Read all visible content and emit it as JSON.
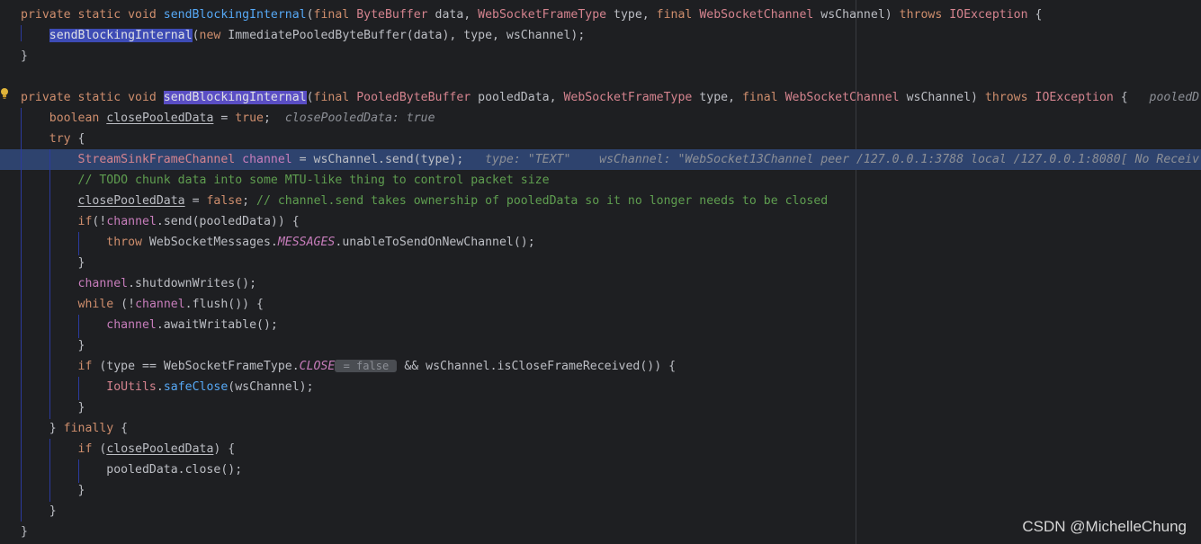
{
  "editor": {
    "lines": [
      {
        "tokens": [
          {
            "t": "private static void ",
            "c": "k"
          },
          {
            "t": "sendBlockingInternal",
            "c": "f"
          },
          {
            "t": "(",
            "c": ""
          },
          {
            "t": "final ",
            "c": "k"
          },
          {
            "t": "ByteBuffer",
            "c": "t"
          },
          {
            "t": " data, ",
            "c": ""
          },
          {
            "t": "WebSocketFrameType",
            "c": "t"
          },
          {
            "t": " type, ",
            "c": ""
          },
          {
            "t": "final ",
            "c": "k"
          },
          {
            "t": "WebSocketChannel",
            "c": "t"
          },
          {
            "t": " wsChannel) ",
            "c": ""
          },
          {
            "t": "throws ",
            "c": "k"
          },
          {
            "t": "IOException",
            "c": "t"
          },
          {
            "t": " {",
            "c": ""
          }
        ]
      },
      {
        "tokens": [
          {
            "t": "    ",
            "c": ""
          },
          {
            "t": "sendBlockingInternal",
            "c": "hl-ref"
          },
          {
            "t": "(",
            "c": ""
          },
          {
            "t": "new ",
            "c": "k"
          },
          {
            "t": "ImmediatePooledByteBuffer(data), type, wsChannel);",
            "c": ""
          }
        ]
      },
      {
        "tokens": [
          {
            "t": "}",
            "c": ""
          }
        ]
      },
      {
        "tokens": []
      },
      {
        "tokens": [
          {
            "t": "private static void ",
            "c": "k"
          },
          {
            "t": "sendBlockingInternal",
            "c": "hl-decl"
          },
          {
            "t": "(",
            "c": ""
          },
          {
            "t": "final ",
            "c": "k"
          },
          {
            "t": "PooledByteBuffer",
            "c": "t"
          },
          {
            "t": " pooledData, ",
            "c": ""
          },
          {
            "t": "WebSocketFrameType",
            "c": "t"
          },
          {
            "t": " type, ",
            "c": ""
          },
          {
            "t": "final ",
            "c": "k"
          },
          {
            "t": "WebSocketChannel",
            "c": "t"
          },
          {
            "t": " wsChannel) ",
            "c": ""
          },
          {
            "t": "throws ",
            "c": "k"
          },
          {
            "t": "IOException",
            "c": "t"
          },
          {
            "t": " {  ",
            "c": ""
          },
          {
            "t": " pooledD",
            "c": "hint"
          }
        ]
      },
      {
        "tokens": [
          {
            "t": "    ",
            "c": ""
          },
          {
            "t": "boolean ",
            "c": "k"
          },
          {
            "t": "closePooledData",
            "c": "lv"
          },
          {
            "t": " = ",
            "c": ""
          },
          {
            "t": "true",
            "c": "k"
          },
          {
            "t": ";  ",
            "c": ""
          },
          {
            "t": "closePooledData: true",
            "c": "hint"
          }
        ]
      },
      {
        "tokens": [
          {
            "t": "    ",
            "c": ""
          },
          {
            "t": "try",
            "c": "k"
          },
          {
            "t": " {",
            "c": ""
          }
        ]
      },
      {
        "current": true,
        "tokens": [
          {
            "t": "        ",
            "c": ""
          },
          {
            "t": "StreamSinkFrameChannel",
            "c": "t"
          },
          {
            "t": " ",
            "c": ""
          },
          {
            "t": "channel",
            "c": "v"
          },
          {
            "t": " = wsChannel.send(type);  ",
            "c": ""
          },
          {
            "t": " type: \"TEXT\"    wsChannel: \"WebSocket13Channel peer /127.0.0.1:3788 local /127.0.0.1:8080[ No Receiv",
            "c": "hint"
          }
        ]
      },
      {
        "tokens": [
          {
            "t": "        ",
            "c": ""
          },
          {
            "t": "// TODO chunk data into some MTU-like thing to control packet size",
            "c": "c"
          }
        ]
      },
      {
        "tokens": [
          {
            "t": "        ",
            "c": ""
          },
          {
            "t": "closePooledData",
            "c": "lv"
          },
          {
            "t": " = ",
            "c": ""
          },
          {
            "t": "false",
            "c": "k"
          },
          {
            "t": "; ",
            "c": ""
          },
          {
            "t": "// channel.send takes ownership of pooledData so it no longer needs to be closed",
            "c": "c"
          }
        ]
      },
      {
        "tokens": [
          {
            "t": "        ",
            "c": ""
          },
          {
            "t": "if",
            "c": "k"
          },
          {
            "t": "(!",
            "c": ""
          },
          {
            "t": "channel",
            "c": "v"
          },
          {
            "t": ".send(pooledData)) {",
            "c": ""
          }
        ]
      },
      {
        "tokens": [
          {
            "t": "            ",
            "c": ""
          },
          {
            "t": "throw ",
            "c": "k"
          },
          {
            "t": "WebSocketMessages.",
            "c": ""
          },
          {
            "t": "MESSAGES",
            "c": "st"
          },
          {
            "t": ".unableToSendOnNewChannel();",
            "c": ""
          }
        ]
      },
      {
        "tokens": [
          {
            "t": "        }",
            "c": ""
          }
        ]
      },
      {
        "tokens": [
          {
            "t": "        ",
            "c": ""
          },
          {
            "t": "channel",
            "c": "v"
          },
          {
            "t": ".shutdownWrites();",
            "c": ""
          }
        ]
      },
      {
        "tokens": [
          {
            "t": "        ",
            "c": ""
          },
          {
            "t": "while",
            "c": "k"
          },
          {
            "t": " (!",
            "c": ""
          },
          {
            "t": "channel",
            "c": "v"
          },
          {
            "t": ".flush()) {",
            "c": ""
          }
        ]
      },
      {
        "tokens": [
          {
            "t": "            ",
            "c": ""
          },
          {
            "t": "channel",
            "c": "v"
          },
          {
            "t": ".awaitWritable();",
            "c": ""
          }
        ]
      },
      {
        "tokens": [
          {
            "t": "        }",
            "c": ""
          }
        ]
      },
      {
        "tokens": [
          {
            "t": "        ",
            "c": ""
          },
          {
            "t": "if",
            "c": "k"
          },
          {
            "t": " (type == WebSocketFrameType.",
            "c": ""
          },
          {
            "t": "CLOSE",
            "c": "st"
          },
          {
            "t": " = false ",
            "c": "inlay"
          },
          {
            "t": " && wsChannel.isCloseFrameReceived()) {",
            "c": ""
          }
        ]
      },
      {
        "tokens": [
          {
            "t": "            ",
            "c": ""
          },
          {
            "t": "IoUtils",
            "c": "t"
          },
          {
            "t": ".",
            "c": ""
          },
          {
            "t": "safeClose",
            "c": "f"
          },
          {
            "t": "(wsChannel);",
            "c": ""
          }
        ]
      },
      {
        "tokens": [
          {
            "t": "        }",
            "c": ""
          }
        ]
      },
      {
        "tokens": [
          {
            "t": "    } ",
            "c": ""
          },
          {
            "t": "finally",
            "c": "k"
          },
          {
            "t": " {",
            "c": ""
          }
        ]
      },
      {
        "tokens": [
          {
            "t": "        ",
            "c": ""
          },
          {
            "t": "if",
            "c": "k"
          },
          {
            "t": " (",
            "c": ""
          },
          {
            "t": "closePooledData",
            "c": "lv"
          },
          {
            "t": ") {",
            "c": ""
          }
        ]
      },
      {
        "tokens": [
          {
            "t": "            ",
            "c": ""
          },
          {
            "t": "pooledData.close();",
            "c": ""
          }
        ]
      },
      {
        "tokens": [
          {
            "t": "        }",
            "c": ""
          }
        ]
      },
      {
        "tokens": [
          {
            "t": "    }",
            "c": ""
          }
        ]
      },
      {
        "tokens": [
          {
            "t": "}",
            "c": ""
          }
        ]
      }
    ]
  },
  "icons": {
    "gutter": "intention-bulb-icon"
  },
  "colors": {
    "background": "#1e1f22",
    "current_line": "#2e436e",
    "keyword": "#cf8e6d",
    "method": "#56a8f5",
    "type": "#d4838e",
    "comment": "#5f9e50",
    "hint": "#8c8f96"
  },
  "watermark": "CSDN @MichelleChung"
}
